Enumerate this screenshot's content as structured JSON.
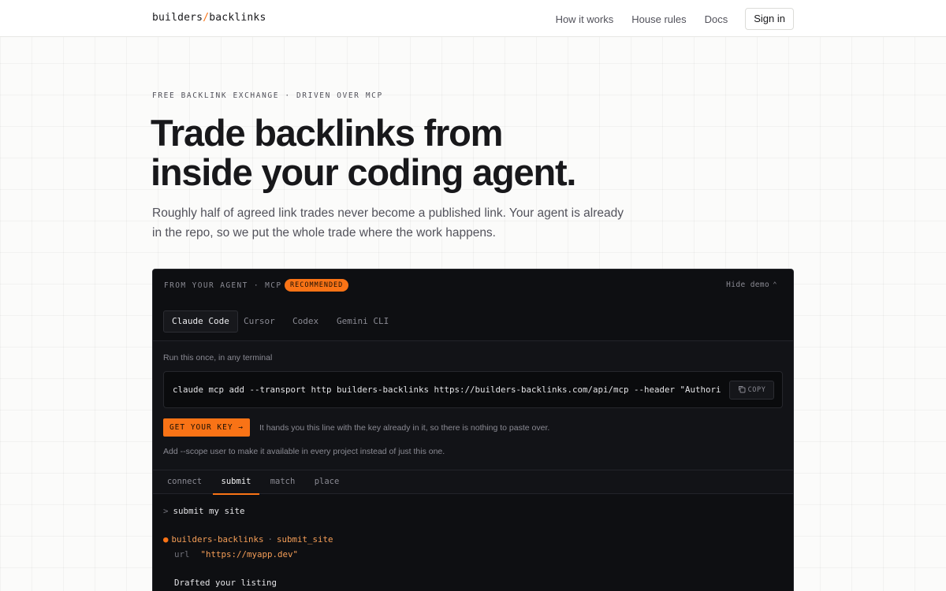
{
  "header": {
    "brand_part1": "builders",
    "brand_slash": "/",
    "brand_part2": "backlinks",
    "nav": [
      {
        "label": "How it works"
      },
      {
        "label": "House rules"
      },
      {
        "label": "Docs"
      }
    ],
    "signin_label": "Sign in"
  },
  "hero": {
    "eyebrow": "FREE BACKLINK EXCHANGE · DRIVEN OVER MCP",
    "headline_line1": "Trade backlinks from",
    "headline_line2": "inside your coding agent.",
    "subhead": "Roughly half of agreed link trades never become a published link. Your agent is already in the repo, so we put the whole trade where the work happens."
  },
  "demo": {
    "label": "FROM YOUR AGENT · MCP",
    "badge": "RECOMMENDED",
    "hide_label": "Hide demo",
    "client_tabs": [
      {
        "label": "Claude Code",
        "active": true
      },
      {
        "label": "Cursor",
        "active": false
      },
      {
        "label": "Codex",
        "active": false
      },
      {
        "label": "Gemini CLI",
        "active": false
      }
    ],
    "run_label": "Run this once, in any terminal",
    "command": "claude mcp add --transport http builders-backlinks https://builders-backlinks.com/api/mcp --header \"Authori",
    "copy_label": "COPY",
    "key_button": "GET YOUR KEY →",
    "key_note": "It hands you this line with the key already in it, so there is nothing to paste over.",
    "scope_note": "Add --scope user to make it available in every project instead of just this one.",
    "flow_tabs": [
      {
        "label": "connect",
        "active": false
      },
      {
        "label": "submit",
        "active": true
      },
      {
        "label": "match",
        "active": false
      },
      {
        "label": "place",
        "active": false
      }
    ],
    "transcript": {
      "prompt_symbol": ">",
      "user_message": "submit my site",
      "tool_dot": "●",
      "tool_server": "builders-backlinks",
      "tool_sep": "·",
      "tool_name": "submit_site",
      "param_key": "url",
      "param_value": "\"https://myapp.dev\"",
      "result": "Drafted your listing"
    }
  },
  "colors": {
    "accent": "#f97316",
    "panel_bg": "#0e0f12",
    "page_bg": "#fbfbfa"
  }
}
